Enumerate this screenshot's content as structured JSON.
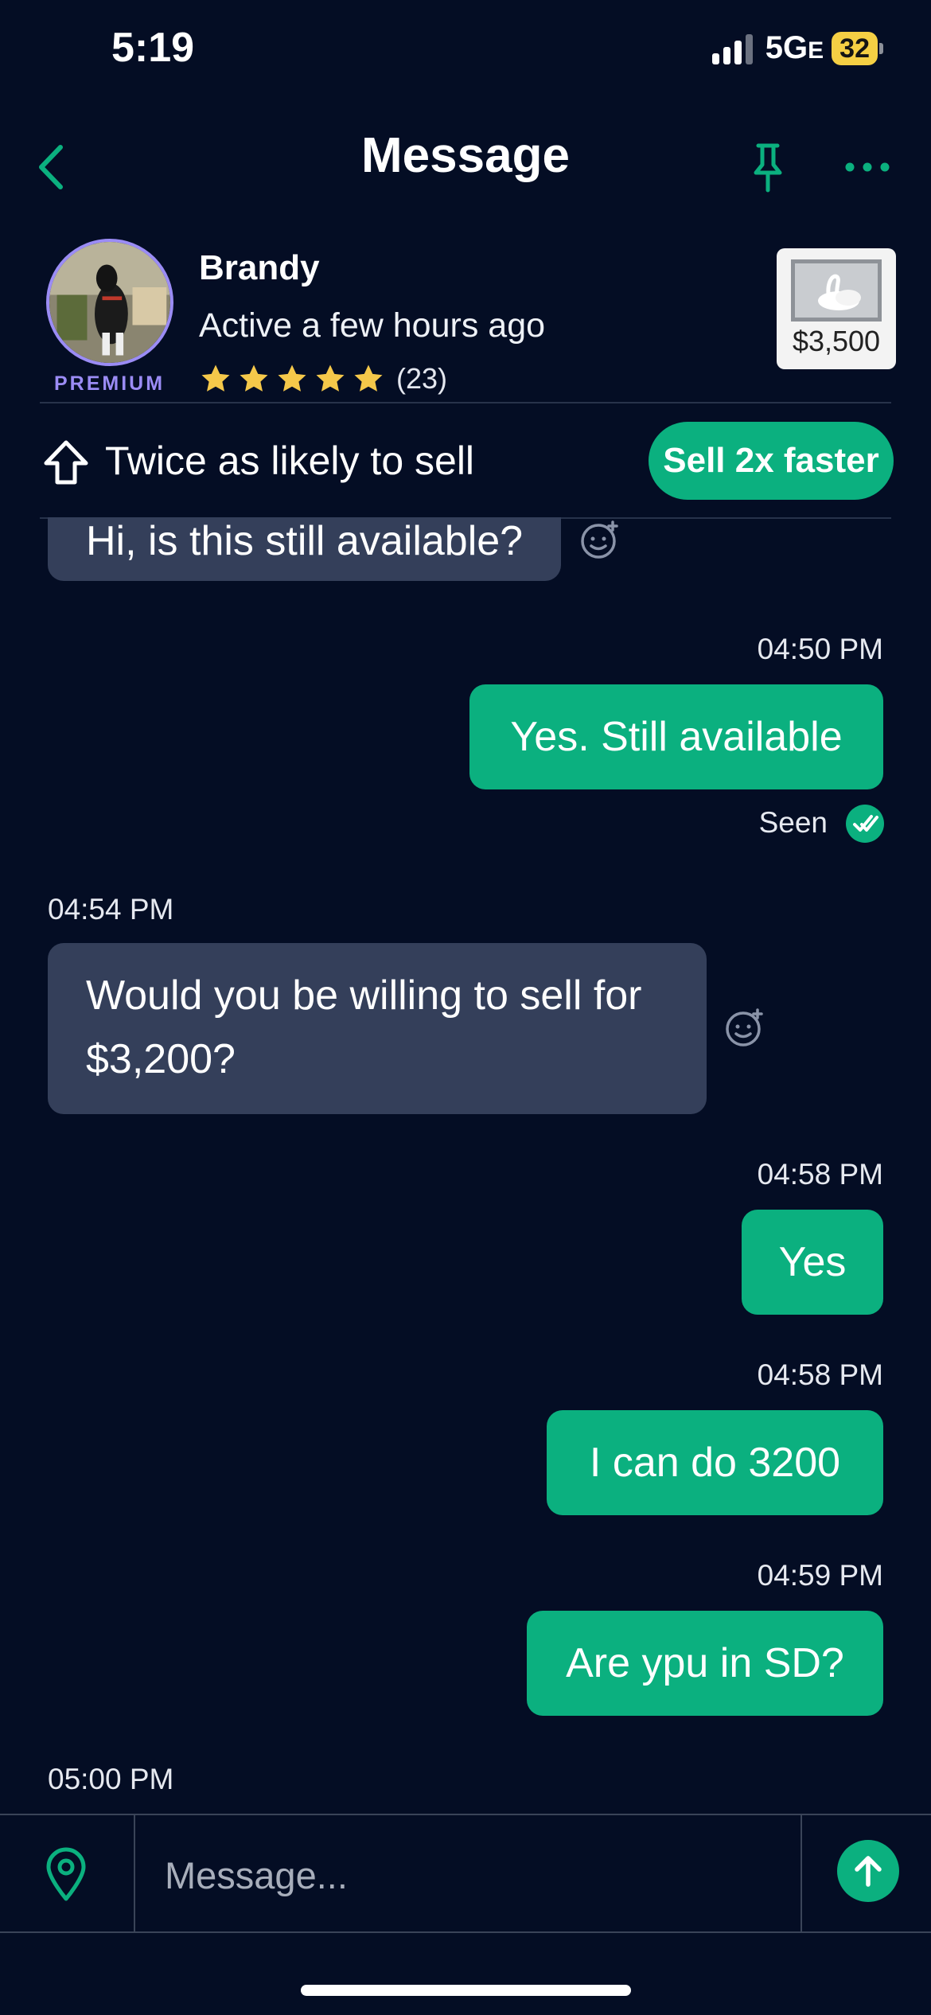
{
  "status_bar": {
    "time": "5:19",
    "network": "5G",
    "network_suffix": "E",
    "battery": "32"
  },
  "nav": {
    "title": "Message",
    "back_icon": "chevron-left-icon",
    "pin_icon": "pin-icon",
    "more_icon": "more-dots-icon"
  },
  "profile": {
    "name": "Brandy",
    "status": "Active a few hours ago",
    "badge": "PREMIUM",
    "rating_stars": 5,
    "rating_count": "(23)"
  },
  "listing": {
    "price": "$3,500"
  },
  "promo": {
    "text": "Twice as likely to sell",
    "button": "Sell 2x faster"
  },
  "messages": [
    {
      "dir": "in",
      "text": "Hi, is this still available?"
    },
    {
      "dir": "out",
      "time": "04:50 PM",
      "text": "Yes. Still available",
      "receipt": "Seen"
    },
    {
      "dir": "in",
      "time": "04:54 PM",
      "text_line1": "Would you be willing to sell for",
      "text_line2": "$3,200?"
    },
    {
      "dir": "out",
      "time": "04:58 PM",
      "text": "Yes"
    },
    {
      "dir": "out",
      "time": "04:58 PM",
      "text": "I can do 3200"
    },
    {
      "dir": "out",
      "time": "04:59 PM",
      "text": "Are ypu in SD?"
    },
    {
      "dir": "in",
      "time": "05:00 PM"
    }
  ],
  "composer": {
    "placeholder": "Message..."
  },
  "colors": {
    "background": "#040d24",
    "accent": "#0bb07f",
    "incoming_bubble": "#343f5a",
    "premium": "#9b8cf5",
    "star": "#f5c84a"
  }
}
